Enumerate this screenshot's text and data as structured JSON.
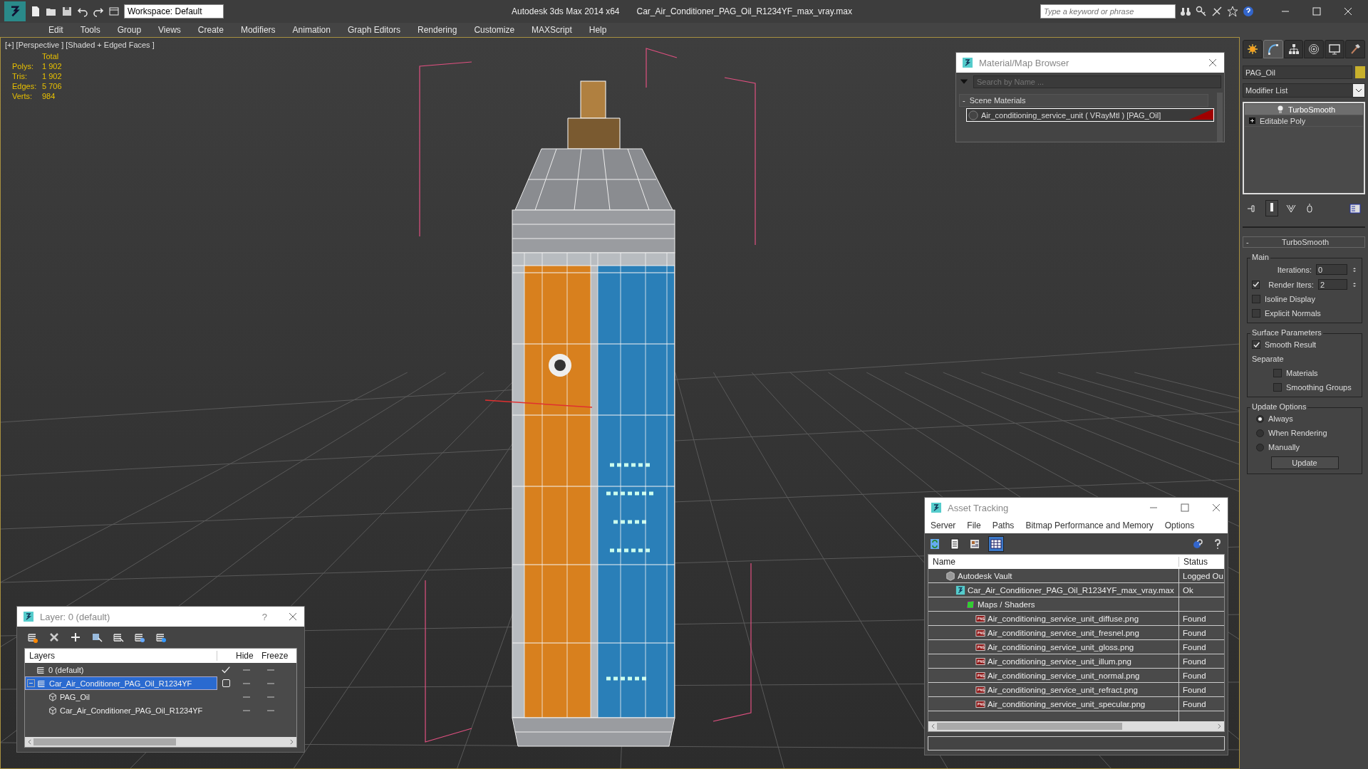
{
  "title_bar": {
    "workspace": "Workspace: Default",
    "app_title": "Autodesk 3ds Max  2014 x64",
    "file_name": "Car_Air_Conditioner_PAG_Oil_R1234YF_max_vray.max",
    "search_placeholder": "Type a keyword or phrase"
  },
  "menu": [
    "Edit",
    "Tools",
    "Group",
    "Views",
    "Create",
    "Modifiers",
    "Animation",
    "Graph Editors",
    "Rendering",
    "Customize",
    "MAXScript",
    "Help"
  ],
  "viewport": {
    "label": "[+] [Perspective ] [Shaded + Edged Faces ]",
    "stats": {
      "header": "Total",
      "rows": [
        {
          "label": "Polys:",
          "value": "1 902"
        },
        {
          "label": "Tris:",
          "value": "1 902"
        },
        {
          "label": "Edges:",
          "value": "5 706"
        },
        {
          "label": "Verts:",
          "value": "984"
        }
      ]
    }
  },
  "material_browser": {
    "title": "Material/Map Browser",
    "search_placeholder": "Search by Name ...",
    "group": {
      "toggle": "-",
      "title": "Scene Materials",
      "materials": [
        {
          "name": "Air_conditioning_service_unit  ( VRayMtl ) [PAG_Oil]",
          "selected": true
        }
      ]
    }
  },
  "asset_tracking": {
    "title": "Asset Tracking",
    "menus": [
      "Server",
      "File",
      "Paths",
      "Bitmap Performance and Memory",
      "Options"
    ],
    "columns": [
      "Name",
      "Status"
    ],
    "rows": [
      {
        "kind": "vault",
        "name": "Autodesk Vault",
        "status": "Logged Ou",
        "children": [
          {
            "kind": "scene",
            "name": "Car_Air_Conditioner_PAG_Oil_R1234YF_max_vray.max",
            "status": "Ok",
            "children": [
              {
                "kind": "folder",
                "name": "Maps / Shaders",
                "children": [
                  {
                    "kind": "bitmap",
                    "name": "Air_conditioning_service_unit_diffuse.png",
                    "status": "Found"
                  },
                  {
                    "kind": "bitmap",
                    "name": "Air_conditioning_service_unit_fresnel.png",
                    "status": "Found"
                  },
                  {
                    "kind": "bitmap",
                    "name": "Air_conditioning_service_unit_gloss.png",
                    "status": "Found"
                  },
                  {
                    "kind": "bitmap",
                    "name": "Air_conditioning_service_unit_illum.png",
                    "status": "Found"
                  },
                  {
                    "kind": "bitmap",
                    "name": "Air_conditioning_service_unit_normal.png",
                    "status": "Found"
                  },
                  {
                    "kind": "bitmap",
                    "name": "Air_conditioning_service_unit_refract.png",
                    "status": "Found"
                  },
                  {
                    "kind": "bitmap",
                    "name": "Air_conditioning_service_unit_specular.png",
                    "status": "Found"
                  }
                ]
              }
            ]
          }
        ]
      }
    ]
  },
  "layer_window": {
    "title": "Layer: 0 (default)",
    "help": "?",
    "columns": {
      "layers": "Layers",
      "hide": "Hide",
      "freeze": "Freeze"
    },
    "rows": [
      {
        "kind": "layer",
        "name": "0 (default)",
        "current": true,
        "selected": false
      },
      {
        "kind": "layer",
        "name": "Car_Air_Conditioner_PAG_Oil_R1234YF",
        "current": false,
        "selected": true,
        "expanded": true,
        "children": [
          {
            "kind": "object",
            "name": "PAG_Oil",
            "selected": false
          },
          {
            "kind": "object",
            "name": "Car_Air_Conditioner_PAG_Oil_R1234YF",
            "selected": false
          }
        ]
      }
    ]
  },
  "command_panel": {
    "tabs": [
      {
        "kind": "create",
        "selected": false
      },
      {
        "kind": "modify",
        "selected": true
      },
      {
        "kind": "hierarchy",
        "selected": false
      },
      {
        "kind": "motion",
        "selected": false
      },
      {
        "kind": "display",
        "selected": false
      },
      {
        "kind": "utilities",
        "selected": false
      }
    ],
    "object_name": "PAG_Oil",
    "modifier_list": "Modifier List",
    "stack": [
      {
        "kind": "modifier",
        "name": "TurboSmooth",
        "selected": true
      },
      {
        "kind": "base",
        "name": "Editable Poly",
        "selected": false
      }
    ],
    "rollout": {
      "toggle": "-",
      "title": "TurboSmooth",
      "groups": [
        {
          "title": "Main",
          "controls": [
            {
              "kind": "spinner",
              "label": "Iterations:",
              "value": "0"
            },
            {
              "kind": "check_spinner",
              "label": "Render Iters:",
              "checked": true,
              "value": "2"
            },
            {
              "kind": "checkbox",
              "label": "Isoline Display",
              "checked": false
            },
            {
              "kind": "checkbox",
              "label": "Explicit Normals",
              "checked": false
            }
          ]
        },
        {
          "title": "Surface Parameters",
          "controls": [
            {
              "kind": "checkbox",
              "label": "Smooth Result",
              "checked": true
            },
            {
              "kind": "label",
              "label": "Separate"
            },
            {
              "kind": "subcheckbox",
              "label": "Materials",
              "checked": false
            },
            {
              "kind": "subcheckbox",
              "label": "Smoothing Groups",
              "checked": false
            }
          ]
        },
        {
          "title": "Update Options",
          "controls": [
            {
              "kind": "radio",
              "label": "Always",
              "selected": true
            },
            {
              "kind": "radio",
              "label": "When Rendering",
              "selected": false
            },
            {
              "kind": "radio",
              "label": "Manually",
              "selected": false
            },
            {
              "kind": "button",
              "label": "Update"
            }
          ]
        }
      ]
    }
  }
}
